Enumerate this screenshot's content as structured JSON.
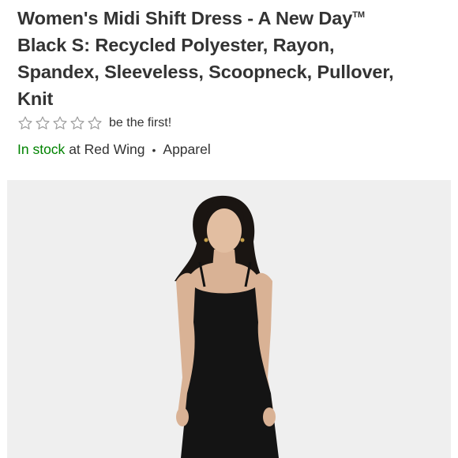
{
  "product": {
    "title_line1": "Women's Midi Shift Dress - A New Day",
    "trademark": "TM",
    "title_line2": "Black S: Recycled Polyester, Rayon,",
    "title_line3": "Spandex, Sleeveless, Scoopneck, Pullover,",
    "title_line4": "Knit"
  },
  "rating": {
    "stars": 0,
    "max_stars": 5,
    "text": "be the first!"
  },
  "availability": {
    "status": "In stock",
    "store_text": "at Red Wing",
    "separator": "•",
    "department": "Apparel"
  },
  "colors": {
    "in_stock": "#008300",
    "photo_background": "#efefef"
  }
}
